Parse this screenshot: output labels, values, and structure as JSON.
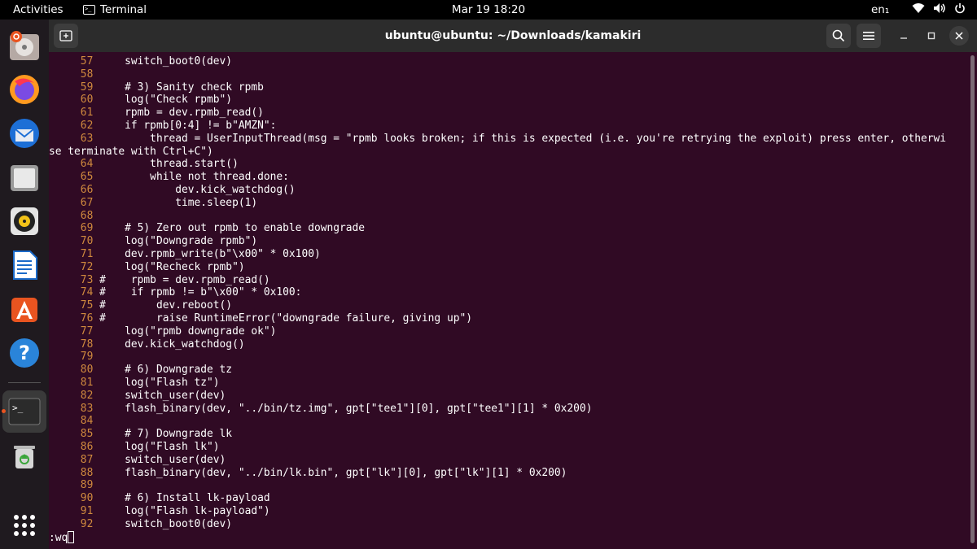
{
  "topbar": {
    "activities": "Activities",
    "app_name": "Terminal",
    "clock": "Mar 19  18:20",
    "language": "en₁"
  },
  "window": {
    "title": "ubuntu@ubuntu: ~/Downloads/kamakiri"
  },
  "dock": {
    "items": [
      "ubuntu-installer-icon",
      "firefox-icon",
      "thunderbird-icon",
      "files-icon",
      "rhythmbox-icon",
      "libreoffice-writer-icon",
      "app-center-icon",
      "help-icon",
      "terminal-icon",
      "trash-icon",
      "show-apps-icon"
    ]
  },
  "terminal": {
    "lines": [
      {
        "n": "57",
        "text": "    switch_boot0(dev)"
      },
      {
        "n": "58",
        "text": ""
      },
      {
        "n": "59",
        "text": "    # 3) Sanity check rpmb"
      },
      {
        "n": "60",
        "text": "    log(\"Check rpmb\")"
      },
      {
        "n": "61",
        "text": "    rpmb = dev.rpmb_read()"
      },
      {
        "n": "62",
        "text": "    if rpmb[0:4] != b\"AMZN\":"
      },
      {
        "n": "63",
        "text": "        thread = UserInputThread(msg = \"rpmb looks broken; if this is expected (i.e. you're retrying the exploit) press enter, otherwi"
      },
      {
        "n": "",
        "text": "se terminate with Ctrl+C\")"
      },
      {
        "n": "64",
        "text": "        thread.start()"
      },
      {
        "n": "65",
        "text": "        while not thread.done:"
      },
      {
        "n": "66",
        "text": "            dev.kick_watchdog()"
      },
      {
        "n": "67",
        "text": "            time.sleep(1)"
      },
      {
        "n": "68",
        "text": ""
      },
      {
        "n": "69",
        "text": "    # 5) Zero out rpmb to enable downgrade"
      },
      {
        "n": "70",
        "text": "    log(\"Downgrade rpmb\")"
      },
      {
        "n": "71",
        "text": "    dev.rpmb_write(b\"\\x00\" * 0x100)"
      },
      {
        "n": "72",
        "text": "    log(\"Recheck rpmb\")"
      },
      {
        "n": "73",
        "text": "#    rpmb = dev.rpmb_read()"
      },
      {
        "n": "74",
        "text": "#    if rpmb != b\"\\x00\" * 0x100:"
      },
      {
        "n": "75",
        "text": "#        dev.reboot()"
      },
      {
        "n": "76",
        "text": "#        raise RuntimeError(\"downgrade failure, giving up\")"
      },
      {
        "n": "77",
        "text": "    log(\"rpmb downgrade ok\")"
      },
      {
        "n": "78",
        "text": "    dev.kick_watchdog()"
      },
      {
        "n": "79",
        "text": ""
      },
      {
        "n": "80",
        "text": "    # 6) Downgrade tz"
      },
      {
        "n": "81",
        "text": "    log(\"Flash tz\")"
      },
      {
        "n": "82",
        "text": "    switch_user(dev)"
      },
      {
        "n": "83",
        "text": "    flash_binary(dev, \"../bin/tz.img\", gpt[\"tee1\"][0], gpt[\"tee1\"][1] * 0x200)"
      },
      {
        "n": "84",
        "text": ""
      },
      {
        "n": "85",
        "text": "    # 7) Downgrade lk"
      },
      {
        "n": "86",
        "text": "    log(\"Flash lk\")"
      },
      {
        "n": "87",
        "text": "    switch_user(dev)"
      },
      {
        "n": "88",
        "text": "    flash_binary(dev, \"../bin/lk.bin\", gpt[\"lk\"][0], gpt[\"lk\"][1] * 0x200)"
      },
      {
        "n": "89",
        "text": ""
      },
      {
        "n": "90",
        "text": "    # 6) Install lk-payload"
      },
      {
        "n": "91",
        "text": "    log(\"Flash lk-payload\")"
      },
      {
        "n": "92",
        "text": "    switch_boot0(dev)"
      }
    ],
    "command": ":wq"
  }
}
